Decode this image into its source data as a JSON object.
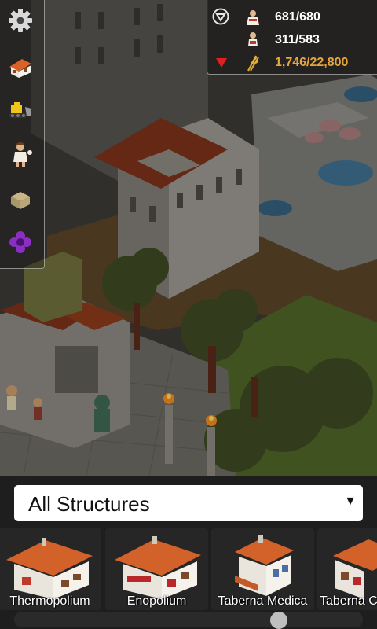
{
  "toolbar": {
    "buttons": [
      {
        "name": "settings",
        "icon": "gear-icon"
      },
      {
        "name": "build",
        "icon": "house-icon"
      },
      {
        "name": "bulldoze",
        "icon": "bulldozer-icon"
      },
      {
        "name": "citizens",
        "icon": "citizen-icon"
      },
      {
        "name": "goods",
        "icon": "crate-icon"
      },
      {
        "name": "religion",
        "icon": "purple-flower-icon"
      }
    ]
  },
  "resources": {
    "filter_icon": "filter-triangle-icon",
    "population": {
      "icon": "plebeian-icon",
      "value": "681/680"
    },
    "workers": {
      "icon": "worker-icon",
      "value": "311/583"
    },
    "wheat": {
      "icon": "wheat-icon",
      "value": "1,746/22,800",
      "alert_icon": "red-down-triangle-icon"
    }
  },
  "build_panel": {
    "category": {
      "selected": "All Structures",
      "arrow": "▼"
    },
    "structures": [
      {
        "label": "Thermopolium"
      },
      {
        "label": "Enopolium"
      },
      {
        "label": "Taberna Medica"
      },
      {
        "label": "Taberna C"
      }
    ]
  },
  "colors": {
    "gold": "#e5a63b",
    "panel_bg": "#1e1e1e",
    "roof_tile": "#c4551f",
    "wall": "#e8e4da"
  }
}
